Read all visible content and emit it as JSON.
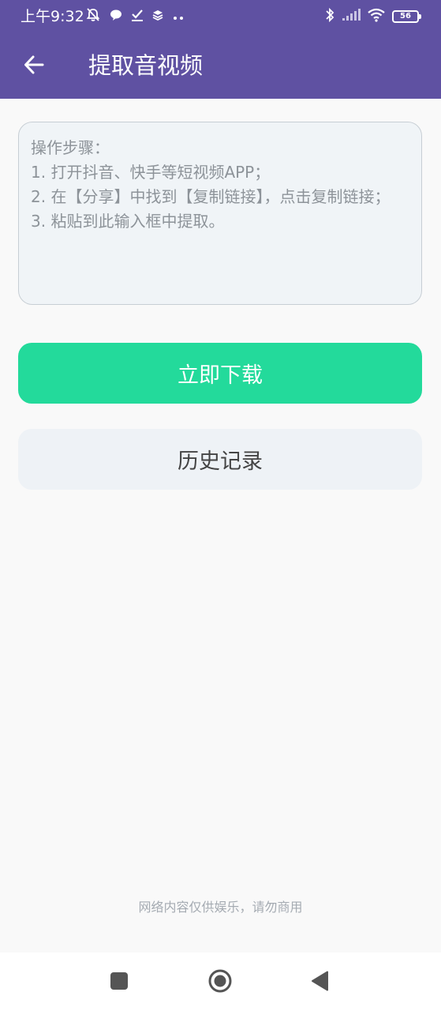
{
  "status_bar": {
    "time": "上午9:32",
    "battery": "56",
    "icons": [
      "muted-bell-icon",
      "chat-bubble-icon",
      "checkmark-icon",
      "layers-icon",
      "more-dots-icon",
      "bluetooth-icon",
      "signal-icon",
      "wifi-icon",
      "battery-icon"
    ]
  },
  "app_bar": {
    "title": "提取音视频",
    "back_icon": "arrow-left-icon"
  },
  "link_input": {
    "placeholder": "操作步骤：\n1. 打开抖音、快手等短视频APP；\n2. 在【分享】中找到【复制链接】，点击复制链接；\n3. 粘贴到此输入框中提取。"
  },
  "buttons": {
    "download": "立即下载",
    "history": "历史记录"
  },
  "footer": {
    "disclaimer": "网络内容仅供娱乐，请勿商用"
  },
  "colors": {
    "header": "#5f51a2",
    "download_button": "#23da9b",
    "history_button": "#eef2f6",
    "background": "#f9f9f9"
  },
  "nav_bar": {
    "icons": [
      "recent-apps-icon",
      "home-icon",
      "back-triangle-icon"
    ]
  }
}
